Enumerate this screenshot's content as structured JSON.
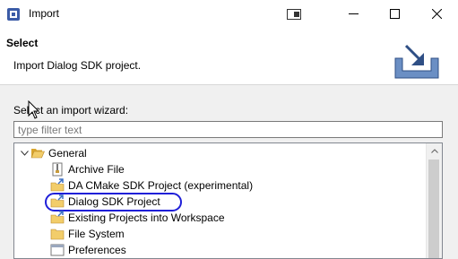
{
  "window": {
    "title": "Import"
  },
  "header": {
    "title": "Select",
    "description": "Import Dialog SDK project."
  },
  "wizard": {
    "label": "Select an import wizard:",
    "filter_placeholder": "type filter text"
  },
  "tree": {
    "items": [
      {
        "label": "General",
        "icon": "folder-open-icon"
      },
      {
        "label": "Archive File",
        "icon": "archive-file-icon"
      },
      {
        "label": "DA CMake SDK Project (experimental)",
        "icon": "import-project-icon"
      },
      {
        "label": "Dialog SDK Project",
        "icon": "import-project-icon"
      },
      {
        "label": "Existing Projects into Workspace",
        "icon": "import-project-icon"
      },
      {
        "label": "File System",
        "icon": "folder-icon"
      },
      {
        "label": "Preferences",
        "icon": "preferences-icon"
      }
    ]
  },
  "colors": {
    "highlight_ring": "#1f1fd8",
    "folder": "#e8b840"
  }
}
